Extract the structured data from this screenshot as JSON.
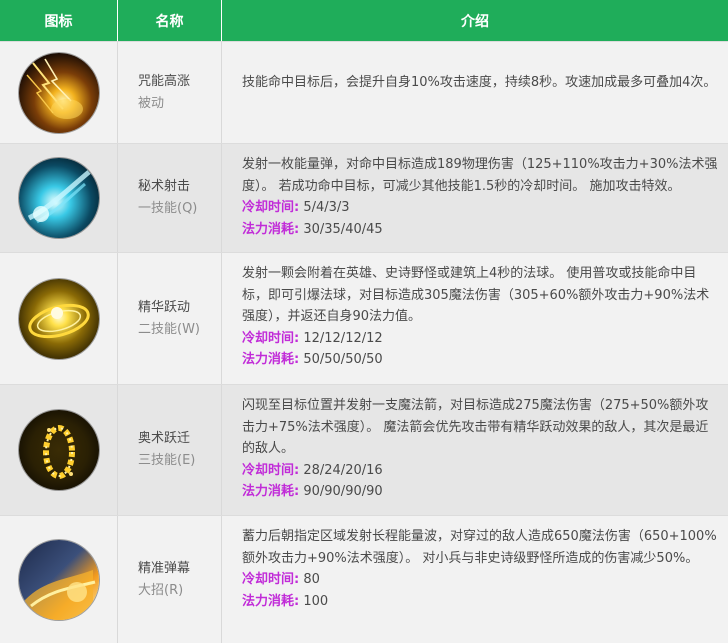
{
  "header": {
    "icon_col": "图标",
    "name_col": "名称",
    "desc_col": "介绍"
  },
  "rows": [
    {
      "icon": "arcane-lightning-claw-icon",
      "name": "咒能高涨",
      "type": "被动",
      "desc": "技能命中目标后，会提升自身10%攻击速度，持续8秒。攻速加成最多可叠加4次。"
    },
    {
      "icon": "blue-energy-bolt-icon",
      "name": "秘术射击",
      "type": "一技能(Q)",
      "desc": "发射一枚能量弹，对命中目标造成189物理伤害（125+110%攻击力+30%法术强度）。 若成功命中目标，可减少其他技能1.5秒的冷却时间。 施加攻击特效。",
      "cd_label": "冷却时间:",
      "cd_value": "5/4/3/3",
      "mana_label": "法力消耗:",
      "mana_value": "30/35/40/45"
    },
    {
      "icon": "golden-orb-icon",
      "name": "精华跃动",
      "type": "二技能(W)",
      "desc": "发射一颗会附着在英雄、史诗野怪或建筑上4秒的法球。 使用普攻或技能命中目标，即可引爆法球，对目标造成305魔法伤害（305+60%额外攻击力+90%法术强度），并返还自身90法力值。",
      "cd_label": "冷却时间:",
      "cd_value": "12/12/12/12",
      "mana_label": "法力消耗:",
      "mana_value": "50/50/50/50"
    },
    {
      "icon": "golden-ring-blink-icon",
      "name": "奥术跃迁",
      "type": "三技能(E)",
      "desc": "闪现至目标位置并发射一支魔法箭，对目标造成275魔法伤害（275+50%额外攻击力+75%法术强度）。 魔法箭会优先攻击带有精华跃动效果的敌人，其次是最近的敌人。",
      "cd_label": "冷却时间:",
      "cd_value": "28/24/20/16",
      "mana_label": "法力消耗:",
      "mana_value": "90/90/90/90"
    },
    {
      "icon": "fiery-wave-icon",
      "name": "精准弹幕",
      "type": "大招(R)",
      "desc": "蓄力后朝指定区域发射长程能量波，对穿过的敌人造成650魔法伤害（650+100%额外攻击力+90%法术强度）。 对小兵与非史诗级野怪所造成的伤害减少50%。",
      "cd_label": "冷却时间:",
      "cd_value": "80",
      "mana_label": "法力消耗:",
      "mana_value": "100"
    }
  ]
}
